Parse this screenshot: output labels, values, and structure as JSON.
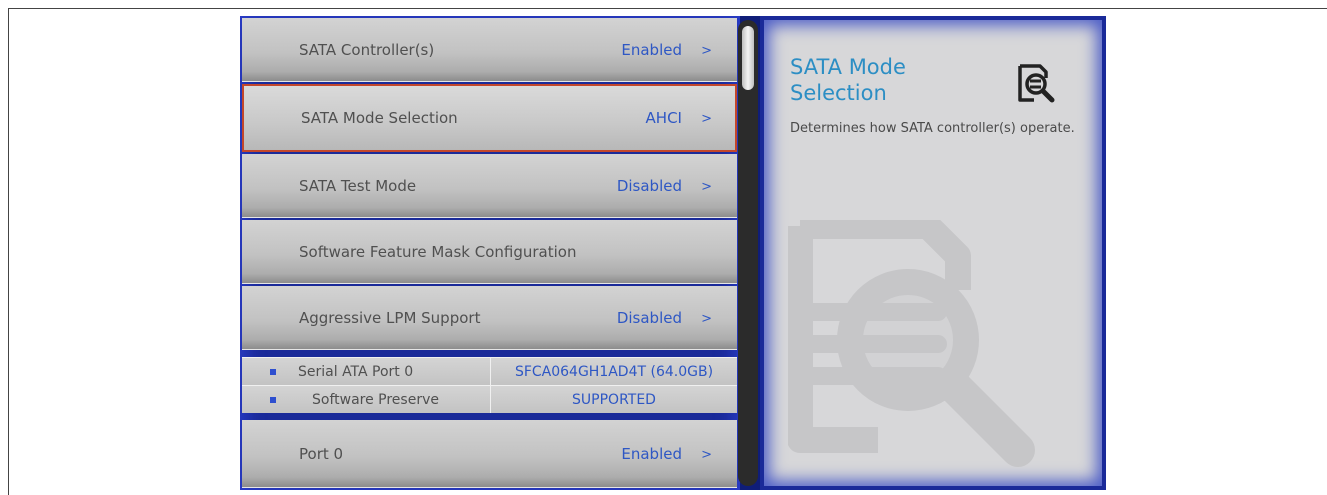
{
  "menu": {
    "items": [
      {
        "label": "SATA Controller(s)",
        "value": "Enabled",
        "chevron": ">"
      },
      {
        "label": "SATA Mode Selection",
        "value": "AHCI",
        "chevron": ">"
      },
      {
        "label": "SATA Test Mode",
        "value": "Disabled",
        "chevron": ">"
      },
      {
        "label": "Software Feature Mask Configuration"
      },
      {
        "label": "Aggressive LPM Support",
        "value": "Disabled",
        "chevron": ">"
      },
      {
        "label": "Port 0",
        "value": "Enabled",
        "chevron": ">"
      }
    ],
    "selected_index": 1
  },
  "port_info": [
    {
      "key": "Serial ATA Port 0",
      "value": "SFCA064GH1AD4T (64.0GB)"
    },
    {
      "key": "Software Preserve",
      "value": "SUPPORTED"
    }
  ],
  "help": {
    "title": "SATA Mode Selection",
    "description": "Determines how SATA controller(s) operate.",
    "icon": "document-search-icon"
  },
  "colors": {
    "accent_blue": "#2e57c4",
    "help_title": "#2c8ec4",
    "selection_border": "#c3472b",
    "panel_blue": "#1a2a99"
  }
}
